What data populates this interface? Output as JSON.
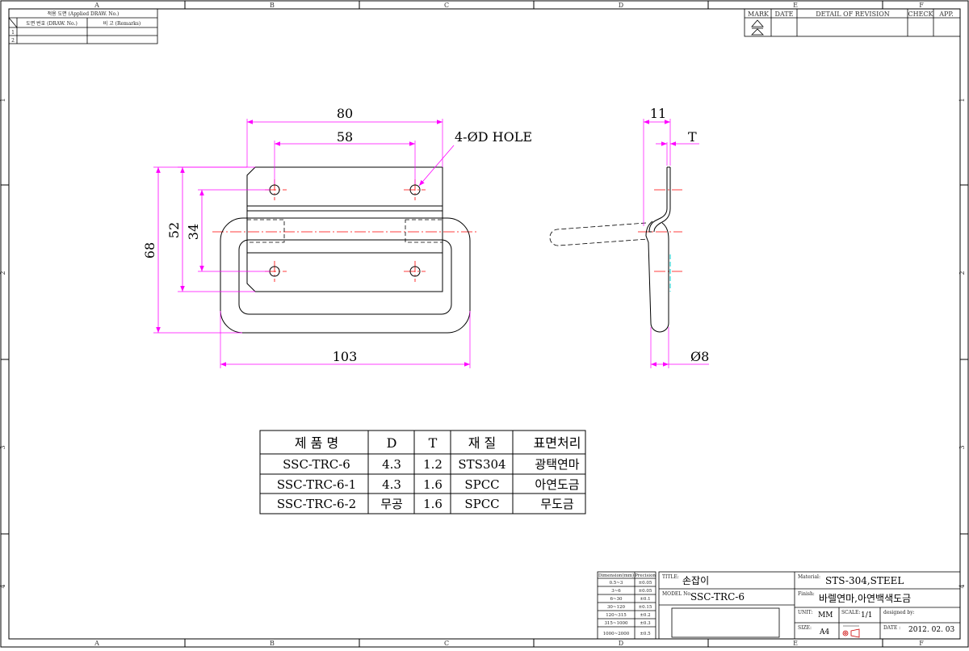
{
  "frame": {
    "zones_top": [
      "A",
      "B",
      "C",
      "D",
      "E",
      "F"
    ],
    "zones_bottom": [
      "A",
      "B",
      "C",
      "D",
      "E",
      "F"
    ],
    "zones_left": [
      "1",
      "2",
      "3",
      "4"
    ],
    "zones_right": [
      "1",
      "2",
      "3",
      "4"
    ]
  },
  "applied_table": {
    "title": "적용 도면 (Applied DRAW. No.)",
    "col1": "도면 번호 (DRAW. No.)",
    "col2": "비 고 (Remarks)",
    "rows": [
      "1",
      "2"
    ]
  },
  "revision_table": {
    "mark": "MARK",
    "date": "DATE",
    "detail": "DETAIL OF REVISION",
    "check": "CHECK",
    "app": "APP."
  },
  "dimensions": {
    "d80": "80",
    "d58": "58",
    "hole": "4-ØD HOLE",
    "d68": "68",
    "d52": "52",
    "d34": "34",
    "d103": "103",
    "d11": "11",
    "t": "T",
    "d8": "Ø8"
  },
  "spec_table": {
    "headers": [
      "제 품 명",
      "D",
      "T",
      "재 질",
      "표면처리"
    ],
    "rows": [
      [
        "SSC-TRC-6",
        "4.3",
        "1.2",
        "STS304",
        "광택연마"
      ],
      [
        "SSC-TRC-6-1",
        "4.3",
        "1.6",
        "SPCC",
        "아연도금"
      ],
      [
        "SSC-TRC-6-2",
        "무공",
        "1.6",
        "SPCC",
        "무도금"
      ]
    ]
  },
  "tolerance_table": {
    "header_dim": "Dimension(mm)",
    "header_prec": "Precision",
    "rows": [
      [
        "0.5~3",
        "±0.05"
      ],
      [
        "3~6",
        "±0.05"
      ],
      [
        "6~30",
        "±0.1"
      ],
      [
        "30~120",
        "±0.15"
      ],
      [
        "120~315",
        "±0.2"
      ],
      [
        "315~1000",
        "±0.3"
      ],
      [
        "1000~2000",
        "±0.5"
      ]
    ]
  },
  "title_block": {
    "title_label": "TITLE:",
    "title": "손잡이",
    "model_label": "MODEL No.",
    "model": "SSC-TRC-6",
    "material_label": "Material:",
    "material": "STS-304,STEEL",
    "finish_label": "Finish:",
    "finish": "바렐연마,아연백색도금",
    "unit_label": "UNIT:",
    "unit": "MM",
    "scale_label": "SCALE:",
    "scale": "1/1",
    "designed_label": "designed by:",
    "size_label": "SIZE:",
    "size": "A4",
    "date_label": "DATE :",
    "date": "2012. 02. 03"
  },
  "colors": {
    "dimension": "#ff00ff",
    "centerline": "#ff0000",
    "hidden": "#00c8c8",
    "outline": "#000000"
  }
}
